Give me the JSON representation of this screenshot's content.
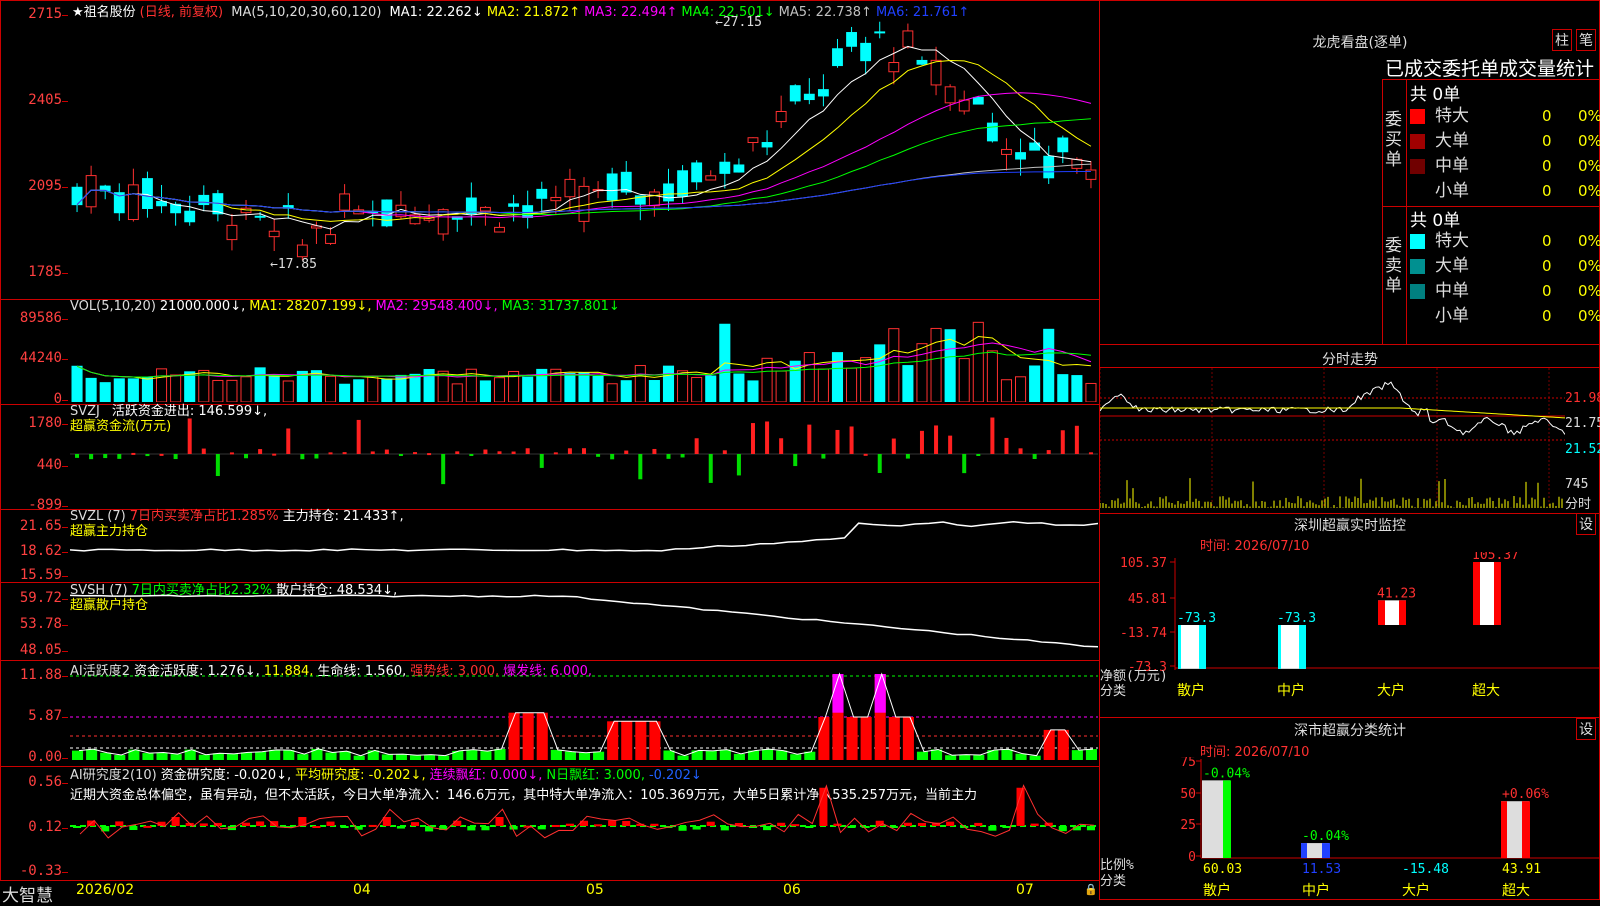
{
  "main_chart": {
    "title_star": "★",
    "stock_name": "祖名股份",
    "mode": "(日线, 前复权)",
    "ma_label": "MA(5,10,20,30,60,120)",
    "ma_values": [
      {
        "label": "MA1: 22.262↓",
        "color": "#ffffff"
      },
      {
        "label": "MA2: 21.872↑",
        "color": "#ffff00"
      },
      {
        "label": "MA3: 22.494↑",
        "color": "#ff00ff"
      },
      {
        "label": "MA4: 22.501↓",
        "color": "#00ff00"
      },
      {
        "label": "MA5: 22.738↑",
        "color": "#c0c0c0"
      },
      {
        "label": "MA6: 21.761↑",
        "color": "#2040ff"
      }
    ],
    "y_labels": [
      "2715",
      "2405",
      "2095",
      "1785"
    ],
    "high_label": "27.15",
    "low_label": "17.85"
  },
  "vol_panel": {
    "name": "VOL(5,10,20)",
    "value": "21000.000↓,",
    "ma1": "MA1: 28207.199↓,",
    "ma2": "MA2: 29548.400↓,",
    "ma3": "MA3: 31737.801↓",
    "y_labels": [
      "89586",
      "44240",
      "0"
    ]
  },
  "svzj_panel": {
    "name": "SVZJ",
    "line1": "活跃资金进出: 146.599↓,",
    "line2": "超赢资金流(万元)",
    "y_labels": [
      "1780",
      "440",
      "-899"
    ]
  },
  "svzl_panel": {
    "name": "SVZL",
    "param": "(7)",
    "ratio": "7日内买卖净占比1.285%",
    "hold": "主力持仓: 21.433↑,",
    "line2": "超赢主力持仓",
    "y_labels": [
      "21.65",
      "18.62",
      "15.59"
    ]
  },
  "svsh_panel": {
    "name": "SVSH",
    "param": "(7)",
    "ratio": "7日内买卖净占比2.32%",
    "hold": "散户持仓: 48.534↓,",
    "line2": "超赢散户持仓",
    "y_labels": [
      "59.72",
      "53.78",
      "48.05"
    ]
  },
  "ai_active_panel": {
    "name": "AI活跃度2",
    "a": "资金活跃度: 1.276↓,",
    "b": "11.884,",
    "c": "生命线: 1.560,",
    "d": "强势线: 3.000,",
    "e": "爆发线: 6.000,",
    "y_labels": [
      "11.88",
      "5.87",
      "0.00"
    ]
  },
  "ai_research_panel": {
    "name": "AI研究度2(10)",
    "a": "资金研究度: -0.020↓,",
    "b": "平均研究度: -0.202↓,",
    "c": "连续飘红: 0.000↓,",
    "d": "N日飘红: 3.000,",
    "e": "-0.202↓",
    "text": "近期大资金总体偏空，虽有异动，但不太活跃，今日大单净流入：146.6万元，其中特大单净流入：105.369万元，大单5日累计净入535.257万元，当前主力",
    "y_labels": [
      "0.56",
      "0.12",
      "-0.33"
    ]
  },
  "bottom_bar": {
    "brand": "大智慧",
    "dates": [
      "2026/02",
      "04",
      "05",
      "06",
      "07"
    ]
  },
  "lhkp": {
    "title": "龙虎看盘(逐单)",
    "btn1": "柱",
    "btn2": "笔",
    "tabs": "已成交委托单成交量统计",
    "buy_label": "委买单",
    "sell_label": "委卖单",
    "buy_total": "共 0单",
    "sell_total": "共 0单",
    "buy_rows": [
      {
        "name": "特大",
        "color": "#ff0000",
        "count": "0",
        "pct": "0%"
      },
      {
        "name": "大单",
        "color": "#a00000",
        "count": "0",
        "pct": "0%"
      },
      {
        "name": "中单",
        "color": "#700000",
        "count": "0",
        "pct": "0%"
      },
      {
        "name": "小单",
        "color": "#000000",
        "count": "0",
        "pct": "0%"
      }
    ],
    "sell_rows": [
      {
        "name": "特大",
        "color": "#00ffff",
        "count": "0",
        "pct": "0%"
      },
      {
        "name": "大单",
        "color": "#009090",
        "count": "0",
        "pct": "0%"
      },
      {
        "name": "中单",
        "color": "#008080",
        "count": "0",
        "pct": "0%"
      },
      {
        "name": "小单",
        "color": "#000000",
        "count": "0",
        "pct": "0%"
      }
    ]
  },
  "intraday": {
    "title": "分时走势",
    "prices": [
      "21.98",
      "21.75",
      "21.52"
    ],
    "vol": "745",
    "vol_unit": "分时"
  },
  "sz_monitor": {
    "title": "深圳超赢实时监控",
    "btn": "设",
    "time": "时间: 2026/07/10",
    "y_labels": [
      "105.37",
      "45.81",
      "-13.74",
      "-73.3"
    ],
    "axis_label": "净额(万元)",
    "axis_label2": "分类",
    "categories": [
      "散户",
      "中户",
      "大户",
      "超大"
    ],
    "values": [
      "-73.3",
      "-73.3",
      "41.23",
      "105.37"
    ]
  },
  "sz_class": {
    "title": "深市超赢分类统计",
    "btn": "设",
    "time": "时间: 2026/07/10",
    "y_labels": [
      "75",
      "50",
      "25",
      "0"
    ],
    "axis_label": "比例%",
    "axis_label2": "分类",
    "categories": [
      "散户",
      "中户",
      "大户",
      "超大"
    ],
    "top_labels": [
      "-0.04%",
      "-0.04%",
      "",
      "+0.06%"
    ],
    "bottom_values": [
      "60.03",
      "11.53",
      "-15.48",
      "43.91"
    ],
    "bar_values": [
      60.03,
      11.53,
      0,
      43.91
    ]
  }
}
